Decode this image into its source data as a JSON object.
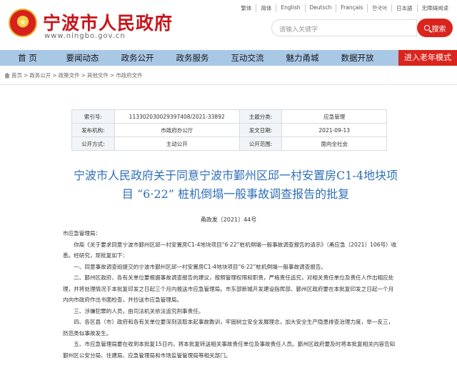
{
  "header": {
    "site_title": "宁波市人民政府",
    "site_url": "www.ningbo.gov.cn",
    "search_placeholder": "请输入关键字",
    "search_button": "搜索",
    "languages": [
      "繁体",
      "简体",
      "English",
      "Deutsch",
      "Français",
      "한국어",
      "日本語",
      "无障碍阅读"
    ]
  },
  "nav": {
    "items": [
      "首  页",
      "要闻动态",
      "政务公开",
      "政务服务",
      "互动交流",
      "魅力甬城",
      "数据开放"
    ],
    "elder_mode": "进入老年模式"
  },
  "breadcrumb": [
    "首页",
    "政务公开",
    "政策文件",
    "其他文件",
    "市政府文件"
  ],
  "meta": {
    "rows": [
      {
        "k1": "索引号:",
        "v1": "113302030029397408/2021-33892",
        "k2": "主题分类:",
        "v2": "应急管理"
      },
      {
        "k1": "发布机构:",
        "v1": "市政府办公厅",
        "k2": "发文日期:",
        "v2": "2021-09-13"
      },
      {
        "k1": "公开方式:",
        "v1": "主动公开",
        "k2": "公开范围:",
        "v2": "面向全社会"
      }
    ]
  },
  "doc": {
    "title_line1": "宁波市人民政府关于同意宁波市鄞州区邱一村安置房C1-4地块项",
    "title_line2": "目 “6·22” 桩机倒塌一般事故调查报告的批复",
    "number": "甬政发〔2021〕44号",
    "paragraphs": [
      "市应急管理局：",
      "你局《关于要求同意宁波市鄞州区邱一村安置房C1-4地块项目“6·22”桩机倒塌一般事故调查报告的请示》（甬应急〔2021〕106号）收悉。经研究，现批复如下：",
      "一、同意事故调查组提交的宁波市鄞州区邱一村安置房C1-4地块项目“6·22”桩机倒塌一般事故调查报告。",
      "二、鄞州区政府、各有关单位要根据事故调查报告的建议，按照管理权限和职责，严格责任追究，对相关责任单位及责任人作出相应处理，并将处理情况于本批复印发之日起三个月内报送市应急管理局。市东部新城开发建设指挥部、鄞州区政府要在本批复印发之日起一个月内向市政府作出书面检查，并抄送市应急管理局。",
      "三、涉嫌犯罪的人员，由司法机关依法追究刑事责任。",
      "四、各区县（市）政府和各有关单位要深刻汲取本起事故教训，牢固树立安全发展理念，加大安全生产隐患排查治理力度，举一反三，防范类似事故发生。",
      "五、市应急管理局要在收到本批复15日内，将本批复转送相关事故责任单位及事故责任人员。鄞州区政府要及时将本批复相关内容告知鄞州区公安分局、住建局、应急管理局和市场监管管理局等相关部门。"
    ]
  }
}
